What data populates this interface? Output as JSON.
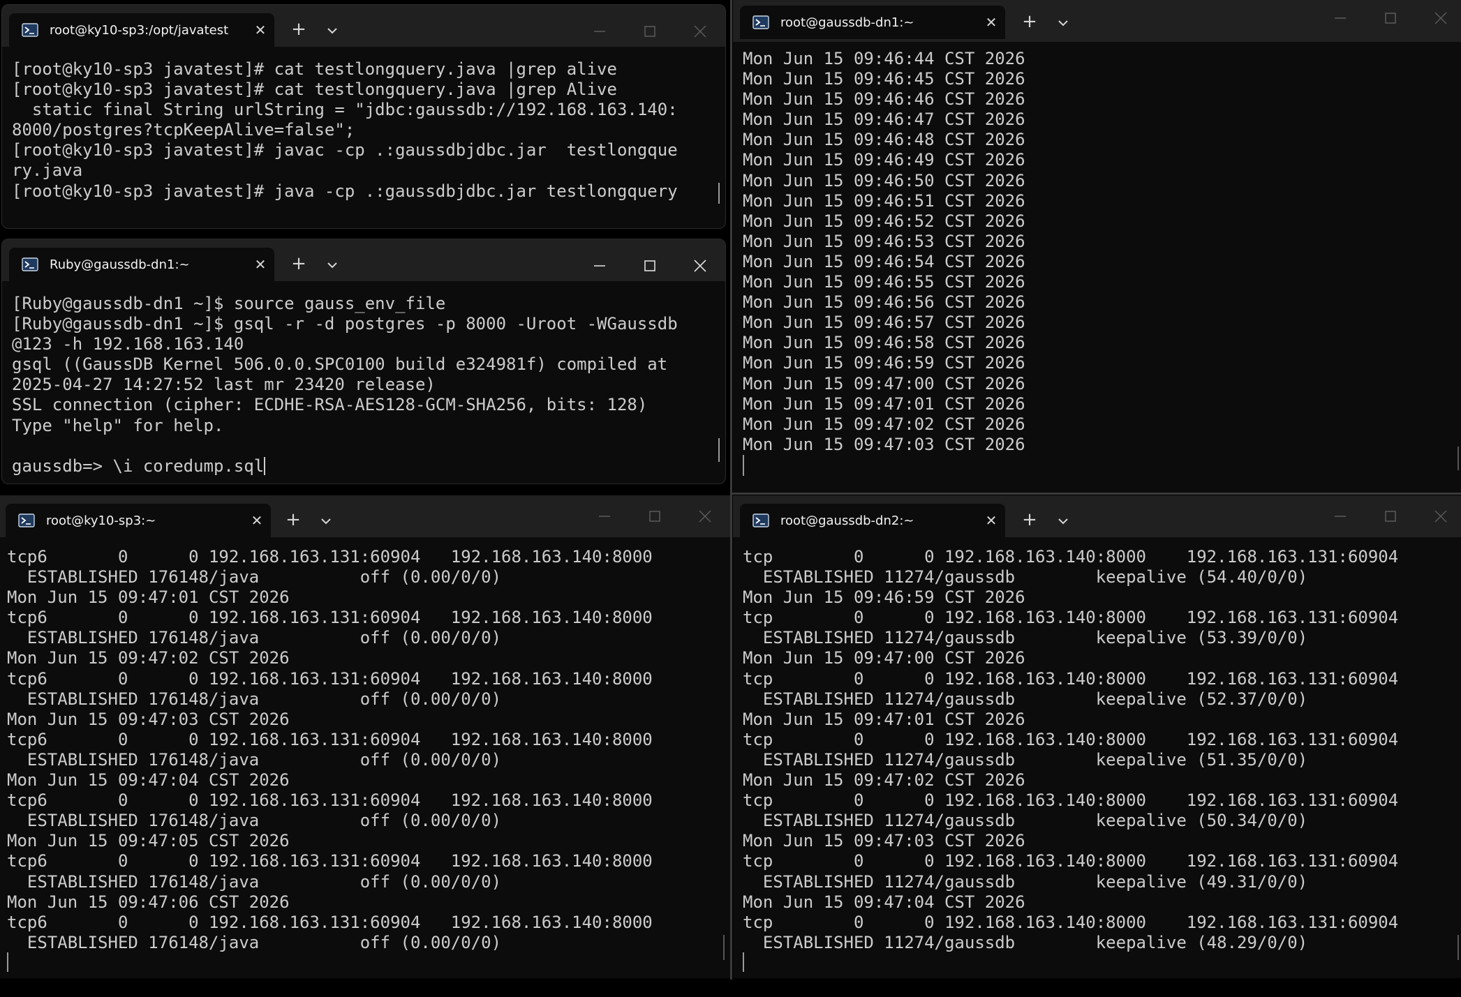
{
  "windows": {
    "java_client": {
      "tab_title": "root@ky10-sp3:/opt/javatest",
      "lines": [
        "[root@ky10-sp3 javatest]# cat testlongquery.java |grep alive",
        "[root@ky10-sp3 javatest]# cat testlongquery.java |grep Alive",
        "  static final String urlString = \"jdbc:gaussdb://192.168.163.140:",
        "8000/postgres?tcpKeepAlive=false\";",
        "[root@ky10-sp3 javatest]# javac -cp .:gaussdbjdbc.jar  testlongque",
        "ry.java",
        "[root@ky10-sp3 javatest]# java -cp .:gaussdbjdbc.jar testlongquery"
      ]
    },
    "gsql_session": {
      "tab_title": "Ruby@gaussdb-dn1:~",
      "lines": [
        "[Ruby@gaussdb-dn1 ~]$ source gauss_env_file",
        "[Ruby@gaussdb-dn1 ~]$ gsql -r -d postgres -p 8000 -Uroot -WGaussdb",
        "@123 -h 192.168.163.140",
        "gsql ((GaussDB Kernel 506.0.0.SPC0100 build e324981f) compiled at",
        "2025-04-27 14:27:52 last mr 23420 release)",
        "SSL connection (cipher: ECDHE-RSA-AES128-GCM-SHA256, bits: 128)",
        "Type \"help\" for help.",
        "",
        "gaussdb=> \\i coredump.sql"
      ]
    },
    "dn1_clock": {
      "tab_title": "root@gaussdb-dn1:~",
      "lines": [
        "Mon Jun 15 09:46:44 CST 2026",
        "Mon Jun 15 09:46:45 CST 2026",
        "Mon Jun 15 09:46:46 CST 2026",
        "Mon Jun 15 09:46:47 CST 2026",
        "Mon Jun 15 09:46:48 CST 2026",
        "Mon Jun 15 09:46:49 CST 2026",
        "Mon Jun 15 09:46:50 CST 2026",
        "Mon Jun 15 09:46:51 CST 2026",
        "Mon Jun 15 09:46:52 CST 2026",
        "Mon Jun 15 09:46:53 CST 2026",
        "Mon Jun 15 09:46:54 CST 2026",
        "Mon Jun 15 09:46:55 CST 2026",
        "Mon Jun 15 09:46:56 CST 2026",
        "Mon Jun 15 09:46:57 CST 2026",
        "Mon Jun 15 09:46:58 CST 2026",
        "Mon Jun 15 09:46:59 CST 2026",
        "Mon Jun 15 09:47:00 CST 2026",
        "Mon Jun 15 09:47:01 CST 2026",
        "Mon Jun 15 09:47:02 CST 2026",
        "Mon Jun 15 09:47:03 CST 2026"
      ]
    },
    "client_netstat": {
      "tab_title": "root@ky10-sp3:~",
      "lines": [
        "tcp6       0      0 192.168.163.131:60904   192.168.163.140:8000",
        "  ESTABLISHED 176148/java          off (0.00/0/0)",
        "Mon Jun 15 09:47:01 CST 2026",
        "tcp6       0      0 192.168.163.131:60904   192.168.163.140:8000",
        "  ESTABLISHED 176148/java          off (0.00/0/0)",
        "Mon Jun 15 09:47:02 CST 2026",
        "tcp6       0      0 192.168.163.131:60904   192.168.163.140:8000",
        "  ESTABLISHED 176148/java          off (0.00/0/0)",
        "Mon Jun 15 09:47:03 CST 2026",
        "tcp6       0      0 192.168.163.131:60904   192.168.163.140:8000",
        "  ESTABLISHED 176148/java          off (0.00/0/0)",
        "Mon Jun 15 09:47:04 CST 2026",
        "tcp6       0      0 192.168.163.131:60904   192.168.163.140:8000",
        "  ESTABLISHED 176148/java          off (0.00/0/0)",
        "Mon Jun 15 09:47:05 CST 2026",
        "tcp6       0      0 192.168.163.131:60904   192.168.163.140:8000",
        "  ESTABLISHED 176148/java          off (0.00/0/0)",
        "Mon Jun 15 09:47:06 CST 2026",
        "tcp6       0      0 192.168.163.131:60904   192.168.163.140:8000",
        "  ESTABLISHED 176148/java          off (0.00/0/0)"
      ]
    },
    "server_netstat": {
      "tab_title": "root@gaussdb-dn2:~",
      "lines": [
        "tcp        0      0 192.168.163.140:8000    192.168.163.131:60904",
        "  ESTABLISHED 11274/gaussdb        keepalive (54.40/0/0)",
        "Mon Jun 15 09:46:59 CST 2026",
        "tcp        0      0 192.168.163.140:8000    192.168.163.131:60904",
        "  ESTABLISHED 11274/gaussdb        keepalive (53.39/0/0)",
        "Mon Jun 15 09:47:00 CST 2026",
        "tcp        0      0 192.168.163.140:8000    192.168.163.131:60904",
        "  ESTABLISHED 11274/gaussdb        keepalive (52.37/0/0)",
        "Mon Jun 15 09:47:01 CST 2026",
        "tcp        0      0 192.168.163.140:8000    192.168.163.131:60904",
        "  ESTABLISHED 11274/gaussdb        keepalive (51.35/0/0)",
        "Mon Jun 15 09:47:02 CST 2026",
        "tcp        0      0 192.168.163.140:8000    192.168.163.131:60904",
        "  ESTABLISHED 11274/gaussdb        keepalive (50.34/0/0)",
        "Mon Jun 15 09:47:03 CST 2026",
        "tcp        0      0 192.168.163.140:8000    192.168.163.131:60904",
        "  ESTABLISHED 11274/gaussdb        keepalive (49.31/0/0)",
        "Mon Jun 15 09:47:04 CST 2026",
        "tcp        0      0 192.168.163.140:8000    192.168.163.131:60904",
        "  ESTABLISHED 11274/gaussdb        keepalive (48.29/0/0)"
      ]
    }
  },
  "theme": {
    "terminal_bg": "#0c0c0c",
    "titlebar_bg": "#202020",
    "text_color": "#cccccc"
  },
  "icons": {
    "tab": "terminal-prompt-icon",
    "new_tab": "plus-icon",
    "tab_menu": "chevron-down-icon",
    "minimize": "minimize-icon",
    "maximize": "maximize-icon",
    "close": "close-icon"
  }
}
